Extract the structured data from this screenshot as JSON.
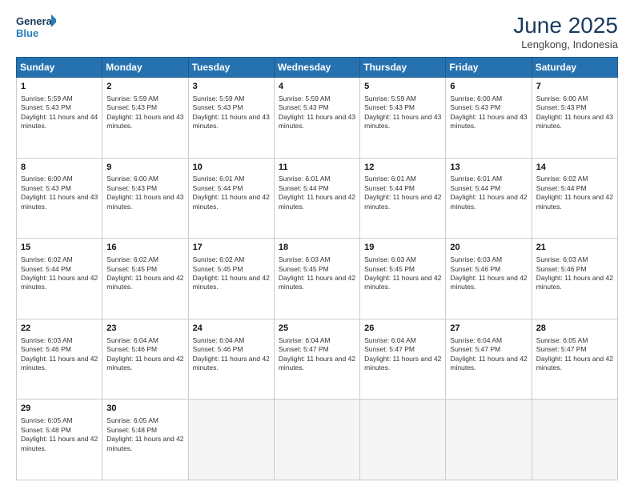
{
  "logo": {
    "line1": "General",
    "line2": "Blue"
  },
  "title": "June 2025",
  "subtitle": "Lengkong, Indonesia",
  "days_header": [
    "Sunday",
    "Monday",
    "Tuesday",
    "Wednesday",
    "Thursday",
    "Friday",
    "Saturday"
  ],
  "weeks": [
    [
      {
        "day": "1",
        "sunrise": "5:59 AM",
        "sunset": "5:43 PM",
        "daylight": "11 hours and 44 minutes."
      },
      {
        "day": "2",
        "sunrise": "5:59 AM",
        "sunset": "5:43 PM",
        "daylight": "11 hours and 43 minutes."
      },
      {
        "day": "3",
        "sunrise": "5:59 AM",
        "sunset": "5:43 PM",
        "daylight": "11 hours and 43 minutes."
      },
      {
        "day": "4",
        "sunrise": "5:59 AM",
        "sunset": "5:43 PM",
        "daylight": "11 hours and 43 minutes."
      },
      {
        "day": "5",
        "sunrise": "5:59 AM",
        "sunset": "5:43 PM",
        "daylight": "11 hours and 43 minutes."
      },
      {
        "day": "6",
        "sunrise": "6:00 AM",
        "sunset": "5:43 PM",
        "daylight": "11 hours and 43 minutes."
      },
      {
        "day": "7",
        "sunrise": "6:00 AM",
        "sunset": "5:43 PM",
        "daylight": "11 hours and 43 minutes."
      }
    ],
    [
      {
        "day": "8",
        "sunrise": "6:00 AM",
        "sunset": "5:43 PM",
        "daylight": "11 hours and 43 minutes."
      },
      {
        "day": "9",
        "sunrise": "6:00 AM",
        "sunset": "5:43 PM",
        "daylight": "11 hours and 43 minutes."
      },
      {
        "day": "10",
        "sunrise": "6:01 AM",
        "sunset": "5:44 PM",
        "daylight": "11 hours and 42 minutes."
      },
      {
        "day": "11",
        "sunrise": "6:01 AM",
        "sunset": "5:44 PM",
        "daylight": "11 hours and 42 minutes."
      },
      {
        "day": "12",
        "sunrise": "6:01 AM",
        "sunset": "5:44 PM",
        "daylight": "11 hours and 42 minutes."
      },
      {
        "day": "13",
        "sunrise": "6:01 AM",
        "sunset": "5:44 PM",
        "daylight": "11 hours and 42 minutes."
      },
      {
        "day": "14",
        "sunrise": "6:02 AM",
        "sunset": "5:44 PM",
        "daylight": "11 hours and 42 minutes."
      }
    ],
    [
      {
        "day": "15",
        "sunrise": "6:02 AM",
        "sunset": "5:44 PM",
        "daylight": "11 hours and 42 minutes."
      },
      {
        "day": "16",
        "sunrise": "6:02 AM",
        "sunset": "5:45 PM",
        "daylight": "11 hours and 42 minutes."
      },
      {
        "day": "17",
        "sunrise": "6:02 AM",
        "sunset": "5:45 PM",
        "daylight": "11 hours and 42 minutes."
      },
      {
        "day": "18",
        "sunrise": "6:03 AM",
        "sunset": "5:45 PM",
        "daylight": "11 hours and 42 minutes."
      },
      {
        "day": "19",
        "sunrise": "6:03 AM",
        "sunset": "5:45 PM",
        "daylight": "11 hours and 42 minutes."
      },
      {
        "day": "20",
        "sunrise": "6:03 AM",
        "sunset": "5:46 PM",
        "daylight": "11 hours and 42 minutes."
      },
      {
        "day": "21",
        "sunrise": "6:03 AM",
        "sunset": "5:46 PM",
        "daylight": "11 hours and 42 minutes."
      }
    ],
    [
      {
        "day": "22",
        "sunrise": "6:03 AM",
        "sunset": "5:46 PM",
        "daylight": "11 hours and 42 minutes."
      },
      {
        "day": "23",
        "sunrise": "6:04 AM",
        "sunset": "5:46 PM",
        "daylight": "11 hours and 42 minutes."
      },
      {
        "day": "24",
        "sunrise": "6:04 AM",
        "sunset": "5:46 PM",
        "daylight": "11 hours and 42 minutes."
      },
      {
        "day": "25",
        "sunrise": "6:04 AM",
        "sunset": "5:47 PM",
        "daylight": "11 hours and 42 minutes."
      },
      {
        "day": "26",
        "sunrise": "6:04 AM",
        "sunset": "5:47 PM",
        "daylight": "11 hours and 42 minutes."
      },
      {
        "day": "27",
        "sunrise": "6:04 AM",
        "sunset": "5:47 PM",
        "daylight": "11 hours and 42 minutes."
      },
      {
        "day": "28",
        "sunrise": "6:05 AM",
        "sunset": "5:47 PM",
        "daylight": "11 hours and 42 minutes."
      }
    ],
    [
      {
        "day": "29",
        "sunrise": "6:05 AM",
        "sunset": "5:48 PM",
        "daylight": "11 hours and 42 minutes."
      },
      {
        "day": "30",
        "sunrise": "6:05 AM",
        "sunset": "5:48 PM",
        "daylight": "11 hours and 42 minutes."
      },
      null,
      null,
      null,
      null,
      null
    ]
  ]
}
